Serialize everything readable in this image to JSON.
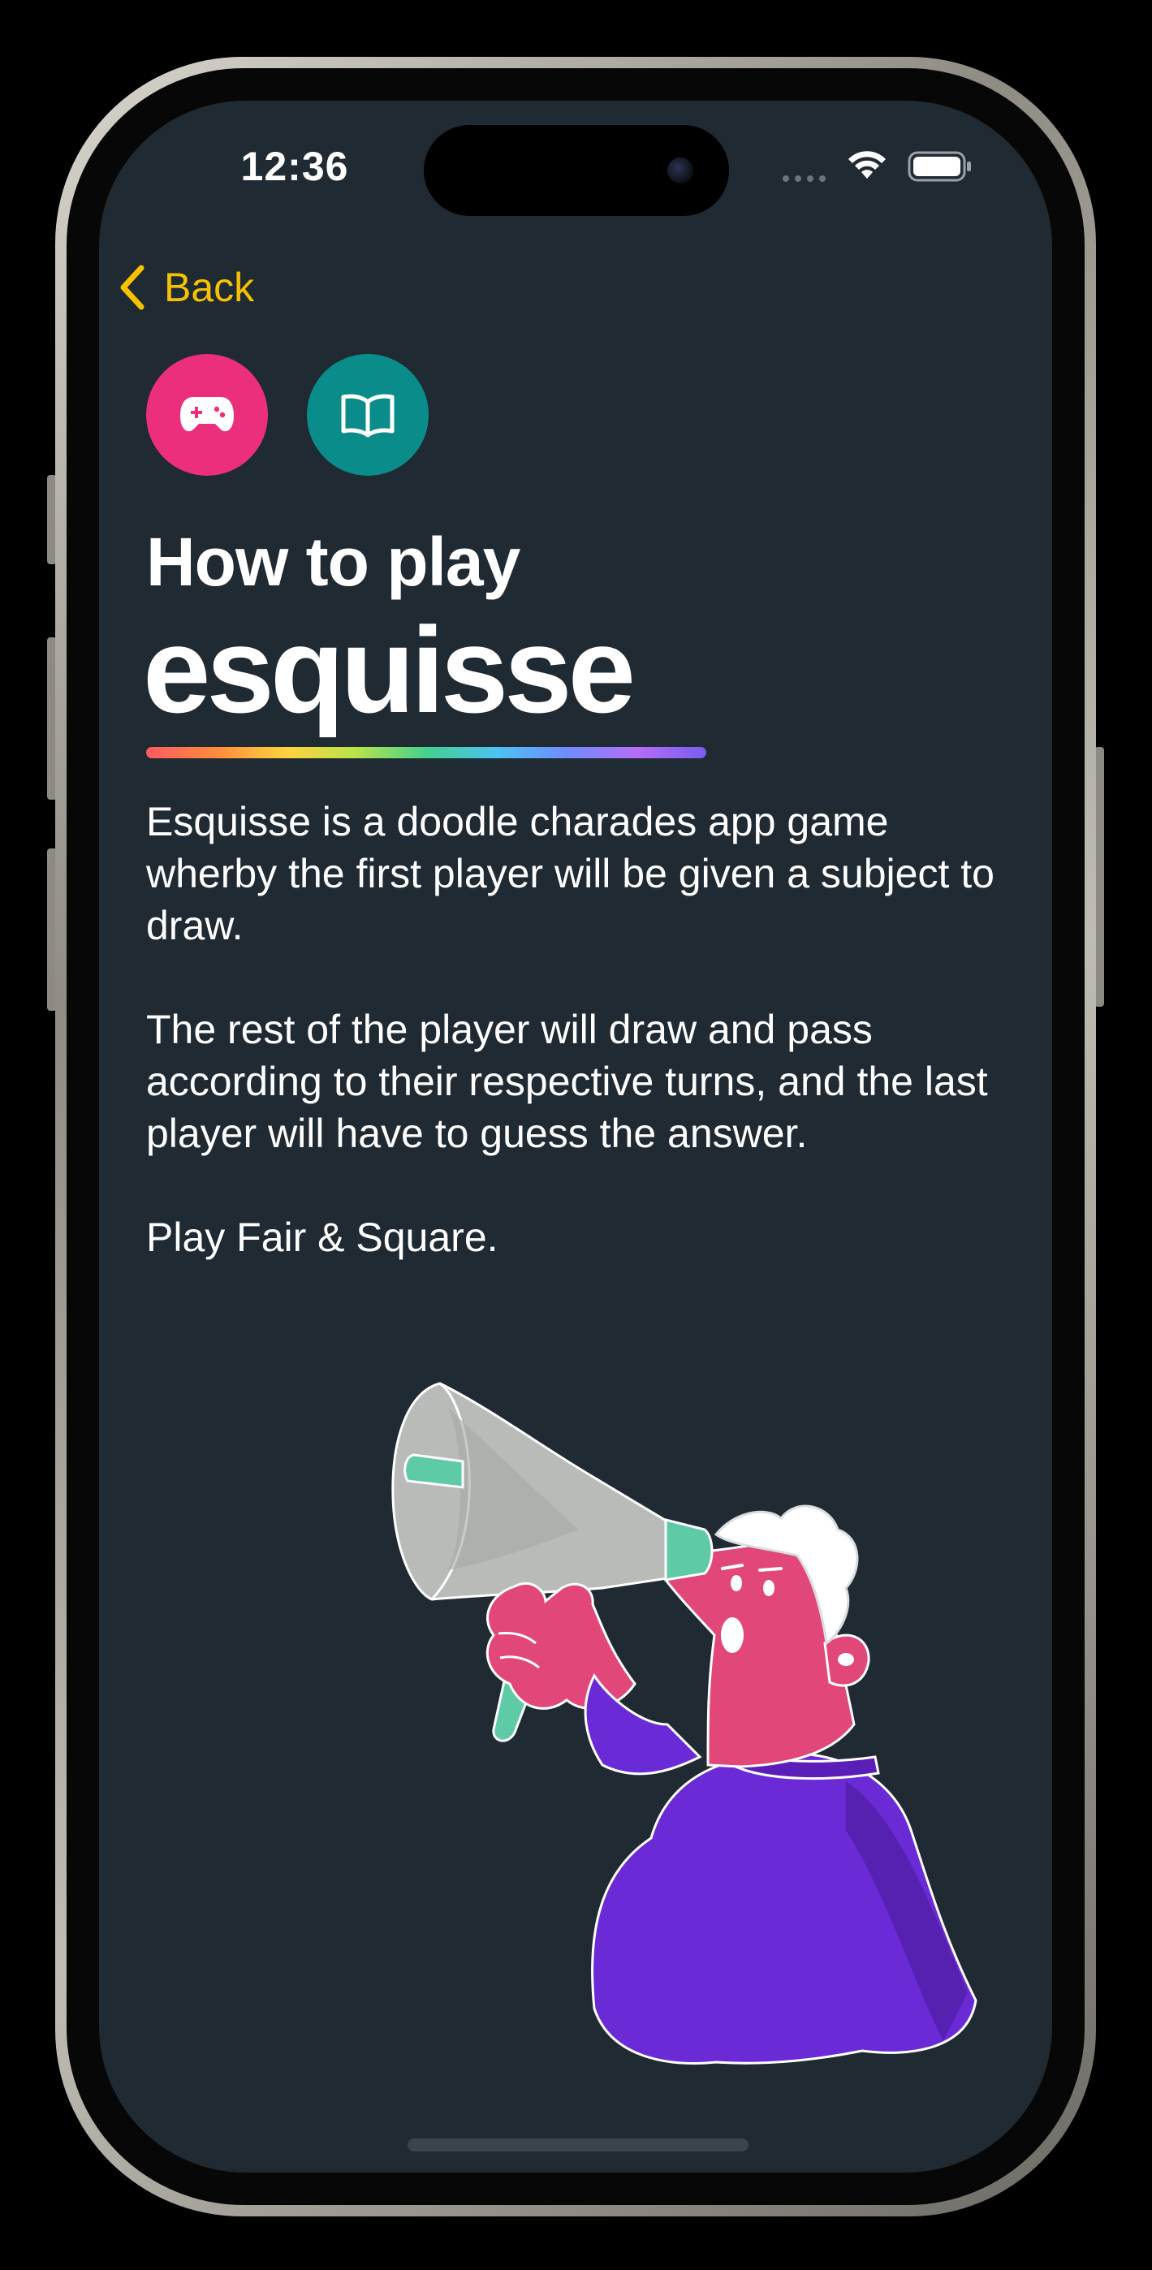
{
  "status_bar": {
    "time": "12:36"
  },
  "nav": {
    "back_label": "Back"
  },
  "icon_buttons": [
    {
      "icon": "gamepad-icon",
      "color": "#ec2f7c"
    },
    {
      "icon": "book-icon",
      "color": "#0a8d8a"
    }
  ],
  "header": {
    "subtitle": "How to play",
    "title": "esquisse"
  },
  "content": {
    "paragraphs": [
      "Esquisse is a doodle charades app game wherby the first player will be given a subject to draw.",
      "The rest of the player will draw and pass according to their respective turns, and the last player will have to guess the answer.",
      "Play Fair & Square."
    ]
  },
  "colors": {
    "background": "#1f2a33",
    "accent": "#f6c100",
    "text": "#ffffff",
    "pink": "#ec2f7c",
    "teal": "#0a8d8a",
    "purple": "#6a2bd6"
  }
}
